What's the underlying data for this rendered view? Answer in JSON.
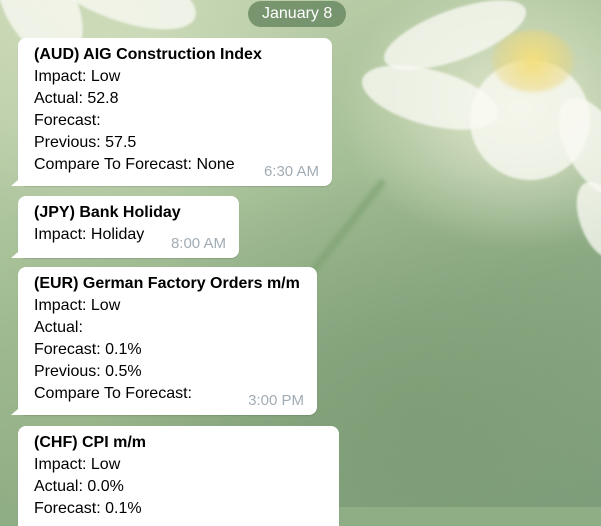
{
  "date_separator": "January 8",
  "messages": [
    {
      "title": "(AUD) AIG Construction Index",
      "lines": [
        "Impact: Low",
        "Actual: 52.8",
        "Forecast:",
        "Previous: 57.5",
        "Compare To Forecast: None"
      ],
      "time": "6:30 AM"
    },
    {
      "title": "(JPY) Bank Holiday",
      "lines": [
        "Impact: Holiday"
      ],
      "time": "8:00 AM"
    },
    {
      "title": "(EUR) German Factory Orders m/m",
      "lines": [
        "Impact: Low",
        "Actual:",
        "Forecast: 0.1%",
        "Previous: 0.5%",
        "Compare To Forecast:"
      ],
      "time": "3:00 PM"
    },
    {
      "title": "(CHF) CPI m/m",
      "lines": [
        "Impact: Low",
        "Actual: 0.0%",
        "Forecast: 0.1%"
      ],
      "time": ""
    }
  ]
}
